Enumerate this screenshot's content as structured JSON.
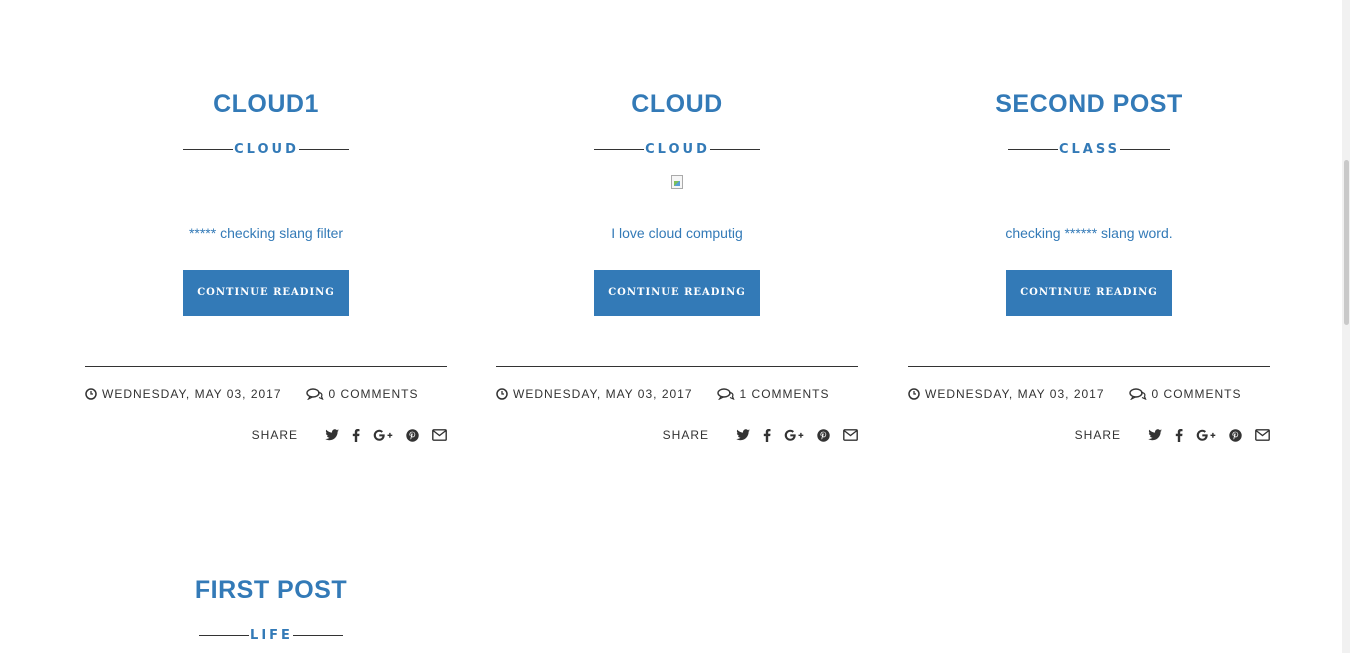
{
  "posts": [
    {
      "title": "CLOUD1",
      "category": "CLOUD",
      "has_image": false,
      "excerpt": "***** checking slang filter",
      "continue_label": "CONTINUE READING",
      "date": "WEDNESDAY, MAY 03, 2017",
      "comments": "0 COMMENTS",
      "share_label": "SHARE"
    },
    {
      "title": "CLOUD",
      "category": "CLOUD",
      "has_image": true,
      "excerpt": "I love cloud computig",
      "continue_label": "CONTINUE READING",
      "date": "WEDNESDAY, MAY 03, 2017",
      "comments": "1 COMMENTS",
      "share_label": "SHARE"
    },
    {
      "title": "SECOND POST",
      "category": "CLASS",
      "has_image": false,
      "excerpt": "checking ****** slang word.",
      "continue_label": "CONTINUE READING",
      "date": "WEDNESDAY, MAY 03, 2017",
      "comments": "0 COMMENTS",
      "share_label": "SHARE"
    },
    {
      "title": "FIRST POST",
      "category": "LIFE"
    }
  ],
  "share_icons": [
    "twitter-icon",
    "facebook-icon",
    "google-plus-icon",
    "pinterest-icon",
    "email-icon"
  ],
  "colors": {
    "accent": "#337ab7",
    "text": "#333333",
    "background": "#ffffff"
  }
}
